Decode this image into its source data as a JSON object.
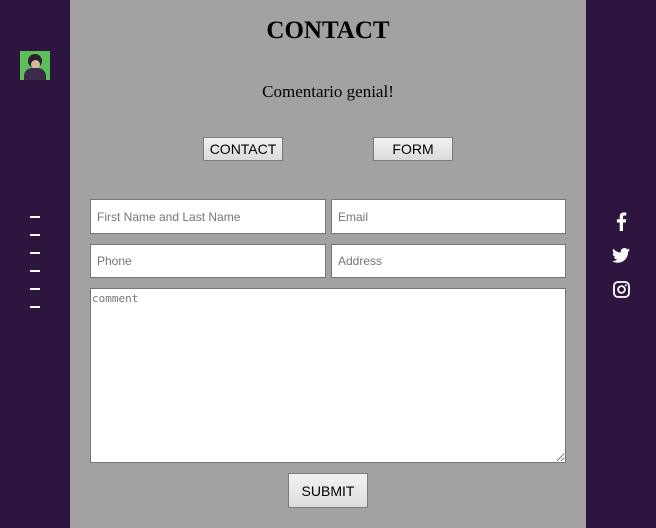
{
  "header": {
    "title": "CONTACT",
    "subtitle": "Comentario genial!"
  },
  "tabs": {
    "contact_label": "CONTACT",
    "form_label": "FORM"
  },
  "form": {
    "name_placeholder": "First Name and Last Name",
    "email_placeholder": "Email",
    "phone_placeholder": "Phone",
    "address_placeholder": "Address",
    "comment_placeholder": "comment",
    "submit_label": "SUBMIT"
  },
  "sidebar": {
    "menu_icon": "hamburger-menu-icon",
    "menu_line_count": 6
  },
  "social": {
    "icons": [
      "facebook-icon",
      "twitter-icon",
      "instagram-icon"
    ]
  },
  "colors": {
    "sidebar_bg": "#2d1540",
    "main_bg": "#a2a2a2",
    "avatar_bg": "#5bbf5a"
  }
}
